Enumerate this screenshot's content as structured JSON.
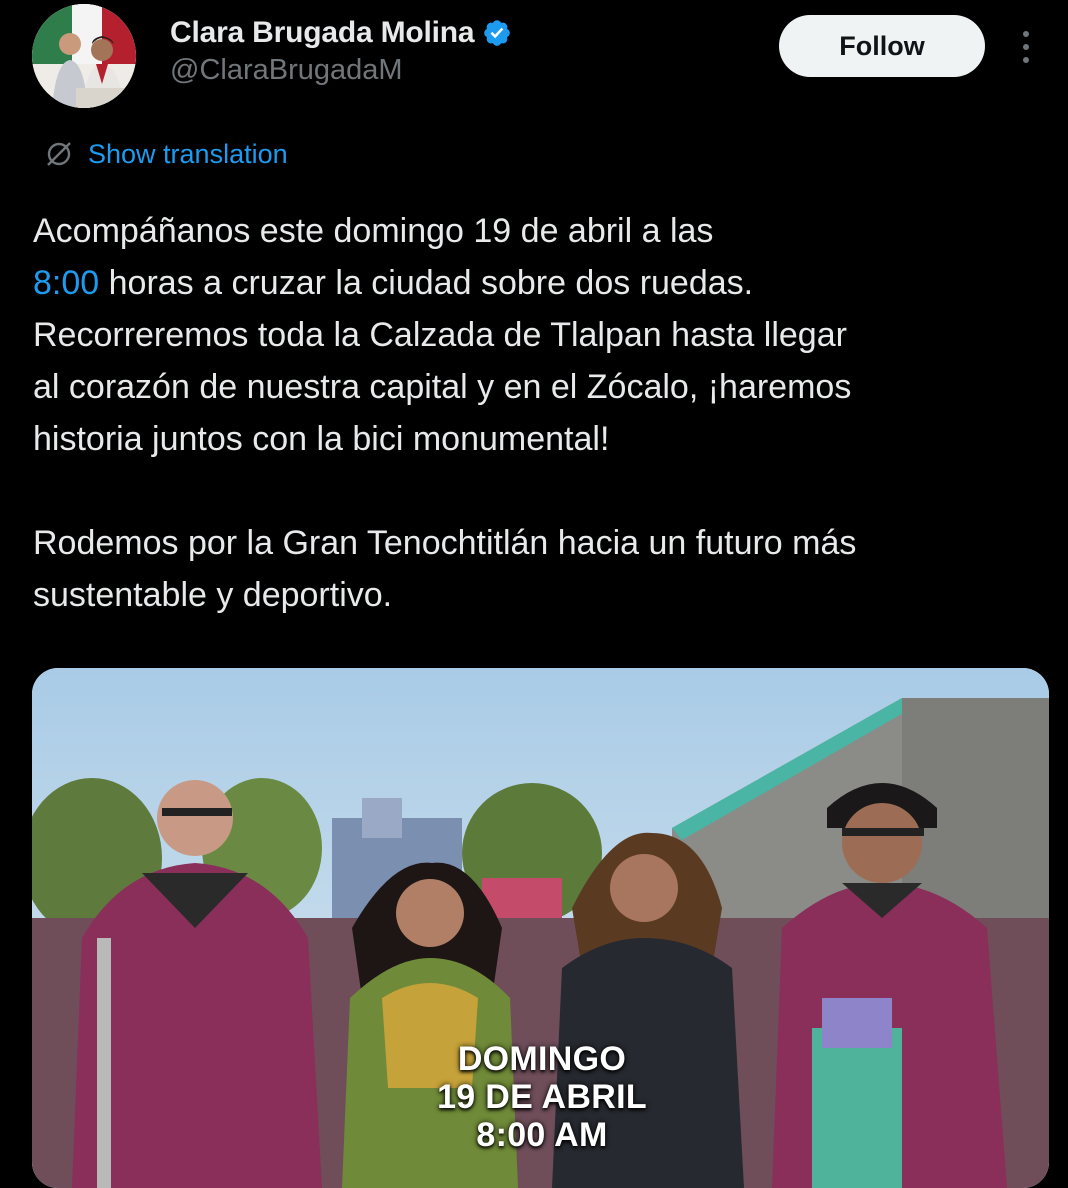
{
  "author": {
    "display_name": "Clara Brugada Molina",
    "handle": "@ClaraBrugadaM",
    "verified": true,
    "avatar_icon": "profile-photo"
  },
  "actions": {
    "follow_label": "Follow",
    "more_icon": "more-vertical-icon"
  },
  "translation": {
    "label": "Show translation",
    "icon": "globe-icon"
  },
  "tweet": {
    "line1": "Acompáñanos este domingo 19 de abril a las",
    "line2_link": "8:00",
    "line2_rest": " horas a cruzar la ciudad sobre dos ruedas.",
    "line3": "Recorreremos toda la Calzada de Tlalpan hasta llegar",
    "line4": "al corazón de nuestra capital y en el Zócalo, ¡haremos",
    "line5": "historia juntos con la bici monumental!",
    "line6": "Rodemos por la Gran Tenochtitlán hacia un futuro más",
    "line7": "sustentable y deportivo."
  },
  "media": {
    "overlay_line1": "DOMINGO",
    "overlay_line2": "19 DE ABRIL",
    "overlay_line3": "8:00 AM"
  },
  "colors": {
    "background": "#000000",
    "text": "#e7e9ea",
    "secondary_text": "#71767b",
    "link": "#1d9bf0",
    "follow_bg": "#eff3f4",
    "verified": "#1d9bf0"
  }
}
